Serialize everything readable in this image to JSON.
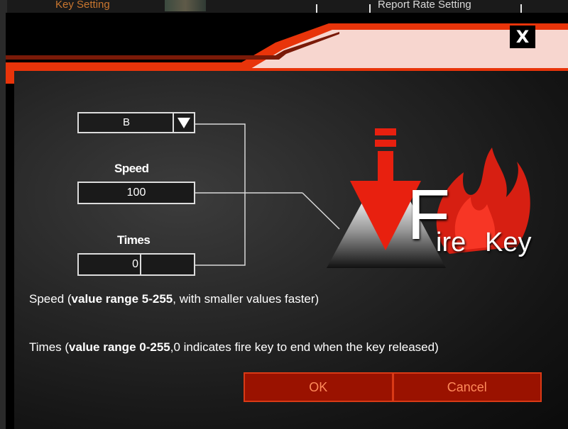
{
  "background": {
    "left_tab_label": "Key Setting",
    "right_tab_label": "Report Rate Setting"
  },
  "dialog": {
    "close_label": "X",
    "key_select": {
      "selected": "B",
      "arrow_icon": "triangle-down-icon"
    },
    "speed": {
      "label": "Speed",
      "value": "100"
    },
    "times": {
      "label": "Times",
      "value": "0"
    },
    "logo": {
      "first_letter": "F",
      "text_1": "ire",
      "text_2": "Key",
      "icon": "fire-key-logo"
    },
    "descriptions": {
      "speed_prefix": "Speed (",
      "speed_bold": "value range 5-255",
      "speed_suffix": ", with smaller values faster)",
      "times_prefix": "Times (",
      "times_bold": "value range 0-255",
      "times_suffix": ",0 indicates fire key to end when the key released)"
    },
    "buttons": {
      "ok": "OK",
      "cancel": "Cancel"
    },
    "colors": {
      "accent": "#e8340a",
      "button_bg": "#9a1200",
      "button_text": "#ff8a5a",
      "header_pink": "#f7d6cf"
    }
  }
}
